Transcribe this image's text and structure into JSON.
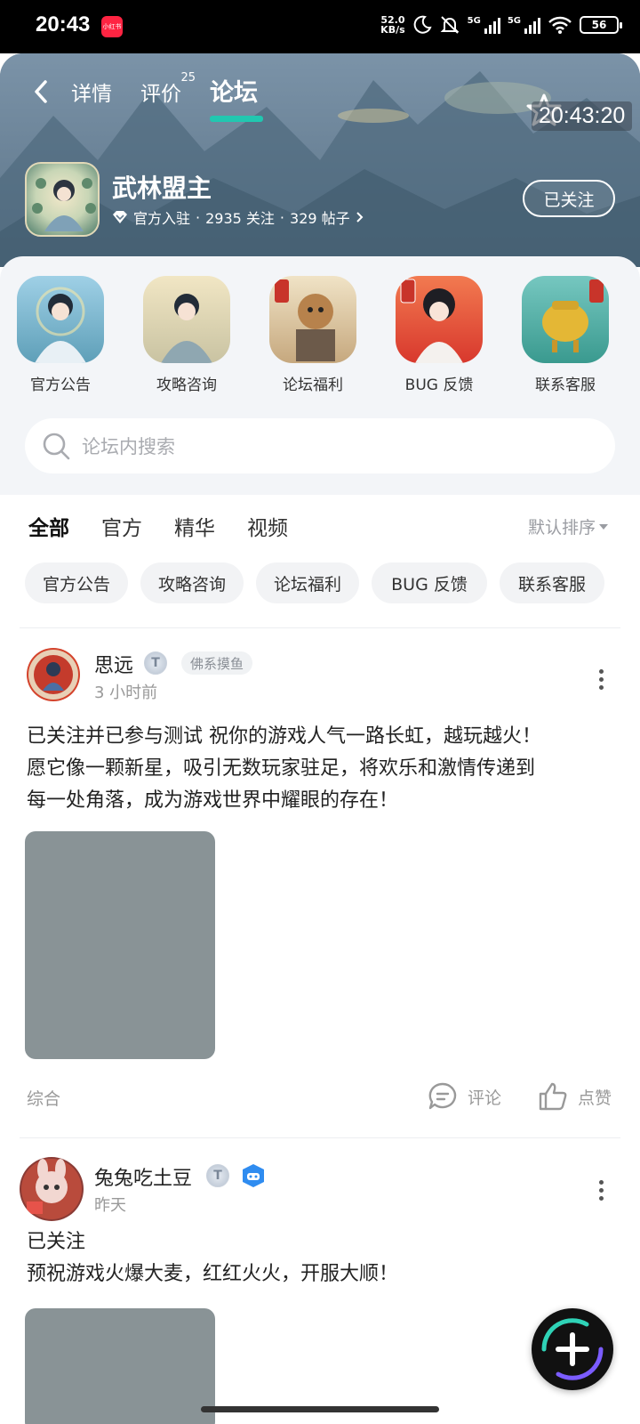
{
  "status_bar": {
    "time": "20:43",
    "app_badge": "小红书",
    "net_speed_value": "52.0",
    "net_speed_unit": "KB/s",
    "signal1_label": "5G",
    "signal2_label": "5G",
    "battery": "56"
  },
  "header": {
    "tabs": [
      {
        "label": "详情"
      },
      {
        "label": "评价",
        "count": "25"
      },
      {
        "label": "论坛"
      }
    ],
    "active_tab": 2,
    "clock_overlay": "20:43:20",
    "game": {
      "name": "武林盟主",
      "official": "官方入驻",
      "follow_count": "2935 关注",
      "post_count": "329 帖子",
      "sep": "·"
    },
    "follow_button": "已关注"
  },
  "categories": [
    {
      "label": "官方公告"
    },
    {
      "label": "攻略咨询"
    },
    {
      "label": "论坛福利"
    },
    {
      "label": "BUG 反馈"
    },
    {
      "label": "联系客服"
    }
  ],
  "search": {
    "placeholder": "论坛内搜索"
  },
  "filter_tabs": [
    "全部",
    "官方",
    "精华",
    "视频"
  ],
  "sort": "默认排序",
  "chips": [
    "官方公告",
    "攻略咨询",
    "论坛福利",
    "BUG 反馈",
    "联系客服"
  ],
  "posts": [
    {
      "user": "思远",
      "badge": "T",
      "tag": "佛系摸鱼",
      "time": "3 小时前",
      "text": "已关注并已参与测试 祝你的游戏人气一路长虹，越玩越火！\n愿它像一颗新星，吸引无数玩家驻足，将欢乐和激情传递到\n每一处角落，成为游戏世界中耀眼的存在！",
      "category": "综合",
      "comment": "评论",
      "like": "点赞"
    },
    {
      "user": "兔兔吃土豆",
      "badge": "T",
      "time": "昨天",
      "text": "已关注\n预祝游戏火爆大麦，红红火火，开服大顺！"
    }
  ],
  "colors": {
    "accent": "#21c7b0",
    "header_bg": "#647c8f"
  }
}
